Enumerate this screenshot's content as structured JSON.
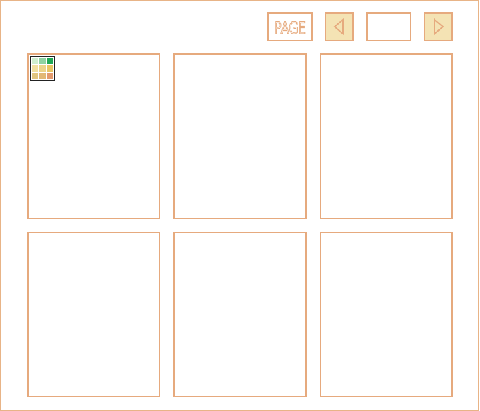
{
  "toolbar": {
    "page_label": "PAGE",
    "page_input_value": "",
    "prev_icon": "triangle-left-icon",
    "next_icon": "triangle-right-icon"
  },
  "colors": {
    "border": "#e6aa7e",
    "button_fill": "#f4e3b4",
    "background": "#ffffff"
  },
  "grid": {
    "tiles": [
      {
        "id": 1,
        "has_thumbnail": true
      },
      {
        "id": 2,
        "has_thumbnail": false
      },
      {
        "id": 3,
        "has_thumbnail": false
      },
      {
        "id": 4,
        "has_thumbnail": false
      },
      {
        "id": 5,
        "has_thumbnail": false
      },
      {
        "id": 6,
        "has_thumbnail": false
      }
    ],
    "thumbnail_icon": "color-grid-icon",
    "thumbnail_colors": [
      "#cfeecf",
      "#8fd3a2",
      "#1fa854",
      "#f1e0a0",
      "#ecd48a",
      "#e8c664",
      "#e2c680",
      "#e2b876",
      "#e39a6e"
    ]
  }
}
